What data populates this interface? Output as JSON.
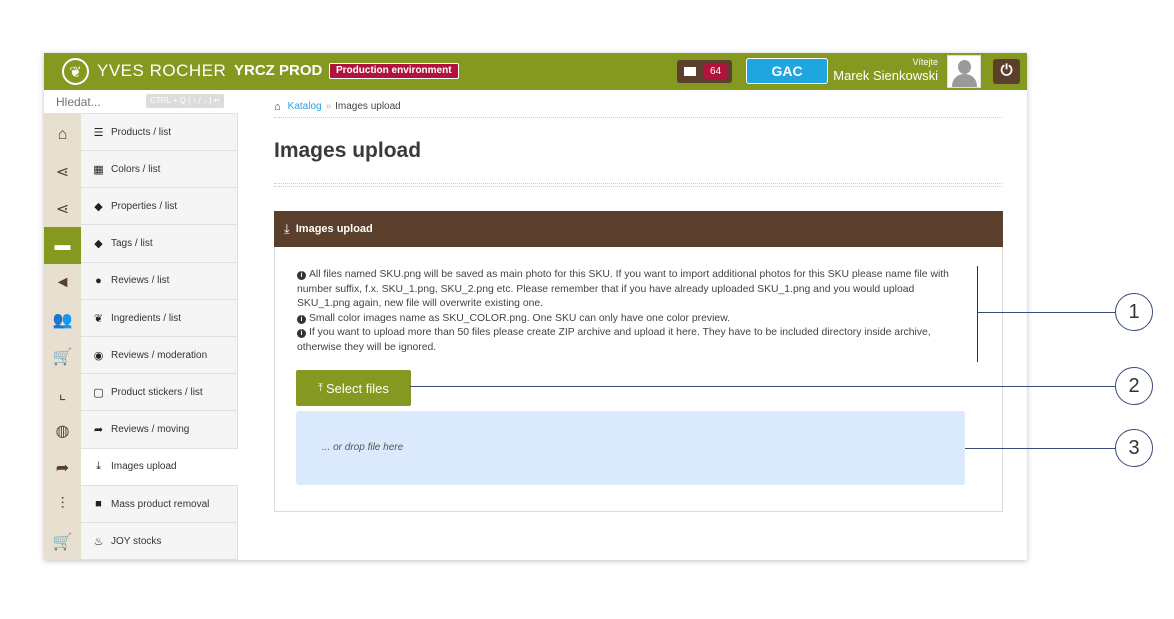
{
  "header": {
    "brand": "YVES ROCHER",
    "logo_icon": "leaf-logo-icon",
    "env_title": "YRCZ PROD",
    "env_badge": "Production environment",
    "messages_count": "64",
    "gac_label": "GAC",
    "greeting": "Vítejte",
    "user_name": "Marek Sienkowski",
    "power_icon": "power-icon",
    "colors": {
      "bar": "#85981f",
      "badge": "#b0143c",
      "gac": "#1fa5e0",
      "dark": "#5a3f2c"
    }
  },
  "search": {
    "placeholder": "Hledat...",
    "hint": "CTRL + Q | ↑ / ↓ | ↵"
  },
  "rail": [
    {
      "icon": "home-icon",
      "glyph": "⌂",
      "active": false
    },
    {
      "icon": "share-icon",
      "glyph": "⋖",
      "active": false
    },
    {
      "icon": "share-icon-2",
      "glyph": "⋖",
      "active": false
    },
    {
      "icon": "folder-icon",
      "glyph": "▬",
      "active": true
    },
    {
      "icon": "megaphone-icon",
      "glyph": "◄",
      "active": false
    },
    {
      "icon": "users-icon",
      "glyph": "👥",
      "active": false
    },
    {
      "icon": "cart-icon",
      "glyph": "🛒",
      "active": false
    },
    {
      "icon": "chart-icon",
      "glyph": "⌞",
      "active": false
    },
    {
      "icon": "globe-icon",
      "glyph": "◍",
      "active": false
    },
    {
      "icon": "forward-icon",
      "glyph": "➦",
      "active": false
    },
    {
      "icon": "sliders-icon",
      "glyph": "⫶",
      "active": false
    },
    {
      "icon": "cart-icon-2",
      "glyph": "🛒",
      "active": false
    }
  ],
  "menu": [
    {
      "label": "Products / list",
      "icon": "list-icon",
      "glyph": "☰",
      "active": false
    },
    {
      "label": "Colors / list",
      "icon": "grid-icon",
      "glyph": "▦",
      "active": false
    },
    {
      "label": "Properties / list",
      "icon": "tag-icon",
      "glyph": "◆",
      "active": false
    },
    {
      "label": "Tags / list",
      "icon": "tags-icon",
      "glyph": "◆",
      "active": false
    },
    {
      "label": "Reviews / list",
      "icon": "comments-icon",
      "glyph": "●",
      "active": false
    },
    {
      "label": "Ingredients / list",
      "icon": "leaf-icon",
      "glyph": "❦",
      "active": false
    },
    {
      "label": "Reviews / moderation",
      "icon": "eye-icon",
      "glyph": "◉",
      "active": false
    },
    {
      "label": "Product stickers / list",
      "icon": "sticker-icon",
      "glyph": "▢",
      "active": false
    },
    {
      "label": "Reviews / moving",
      "icon": "share-arrow-icon",
      "glyph": "➦",
      "active": false
    },
    {
      "label": "Images upload",
      "icon": "download-icon",
      "glyph": "⤓",
      "active": true
    },
    {
      "label": "Mass product removal",
      "icon": "trash-icon",
      "glyph": "■",
      "active": false
    },
    {
      "label": "JOY stocks",
      "icon": "fire-icon",
      "glyph": "♨",
      "active": false
    }
  ],
  "breadcrumb": {
    "link": "Katalog",
    "separator": "»",
    "current": "Images upload"
  },
  "page_title": "Images upload",
  "panel": {
    "title": "Images upload",
    "info": [
      "All files named SKU.png will be saved as main photo for this SKU. If you want to import additional photos for this SKU please name file with number suffix, f.x. SKU_1.png, SKU_2.png etc. Please remember that if you have already uploaded SKU_1.png and you would upload SKU_1.png again, new file will overwrite existing one.",
      "Small color images name as SKU_COLOR.png. One SKU can only have one color preview.",
      "If you want to upload more than 50 files please create ZIP archive and upload it here. They have to be included directory inside archive, otherwise they will be ignored."
    ],
    "select_files": "Select files",
    "drop_text": "... or drop file here"
  },
  "callouts": [
    "1",
    "2",
    "3"
  ]
}
